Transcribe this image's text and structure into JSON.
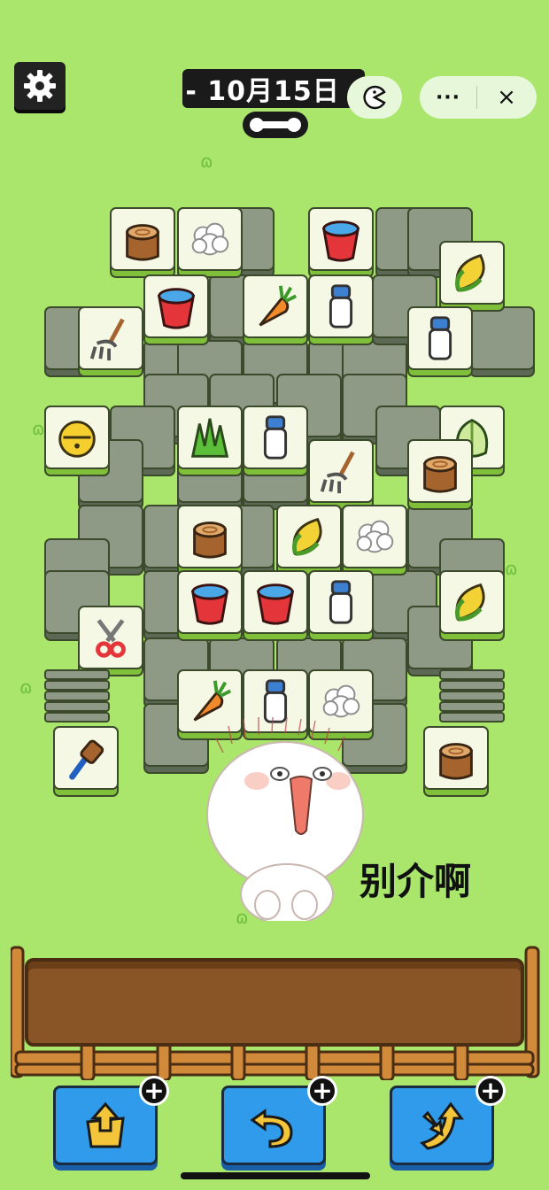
{
  "header": {
    "date": "- 10月15日 -",
    "more_label": "···",
    "close_label": "×"
  },
  "sticker": {
    "text": "别介啊"
  },
  "tools": [
    {
      "name": "remove",
      "plus": "+"
    },
    {
      "name": "undo",
      "plus": "+"
    },
    {
      "name": "shuffle",
      "plus": "+"
    }
  ],
  "colors": {
    "background": "#a9e66b",
    "tray": "#8a5526",
    "button": "#2f9bea"
  },
  "tiles": [
    "stump",
    "rice",
    "bucket",
    "corn",
    "bucket",
    "carrot",
    "milk",
    "pitchfork",
    "milk",
    "bell",
    "grass",
    "milk",
    "cabbage",
    "pitchfork",
    "stump",
    "corn",
    "rice",
    "bucket",
    "bucket",
    "milk",
    "corn",
    "shears",
    "carrot",
    "milk",
    "rice",
    "brush",
    "stump"
  ]
}
